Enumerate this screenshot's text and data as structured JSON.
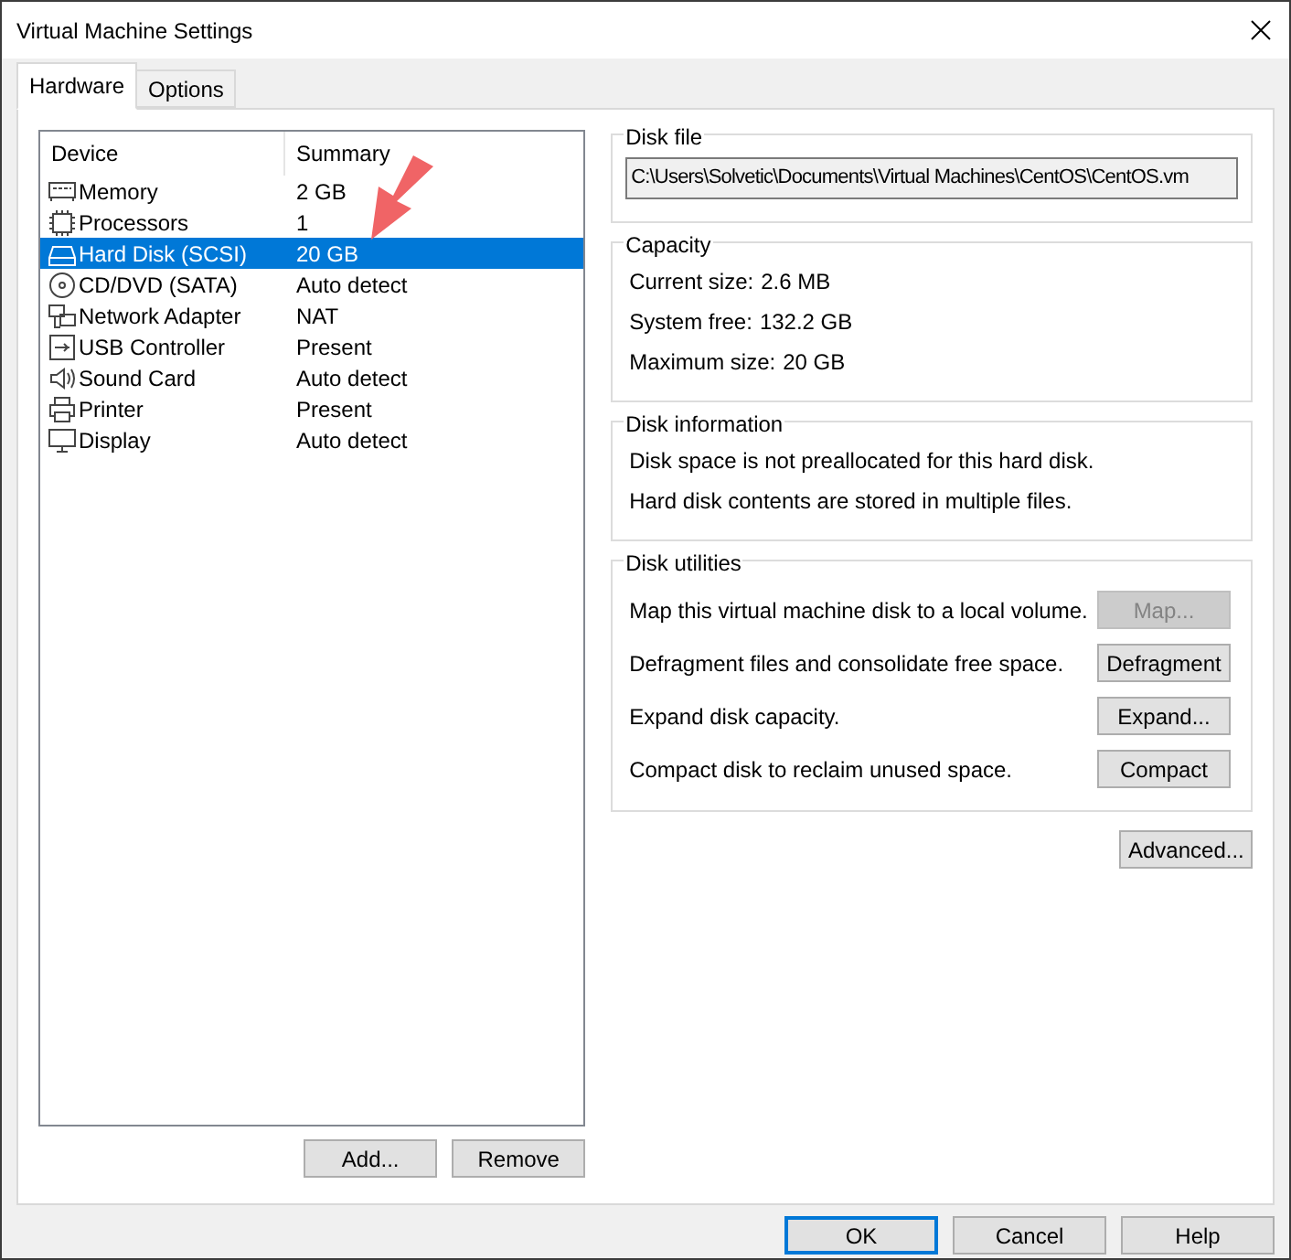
{
  "window": {
    "title": "Virtual Machine Settings"
  },
  "tabs": [
    {
      "label": "Hardware",
      "selected": true
    },
    {
      "label": "Options",
      "selected": false
    }
  ],
  "device_list": {
    "columns": [
      "Device",
      "Summary"
    ],
    "rows": [
      {
        "kind": "memory",
        "device": "Memory",
        "summary": "2 GB",
        "selected": false
      },
      {
        "kind": "processor",
        "device": "Processors",
        "summary": "1",
        "selected": false
      },
      {
        "kind": "disk",
        "device": "Hard Disk (SCSI)",
        "summary": "20 GB",
        "selected": true
      },
      {
        "kind": "cdrom",
        "device": "CD/DVD (SATA)",
        "summary": "Auto detect",
        "selected": false
      },
      {
        "kind": "network",
        "device": "Network Adapter",
        "summary": "NAT",
        "selected": false
      },
      {
        "kind": "usb",
        "device": "USB Controller",
        "summary": "Present",
        "selected": false
      },
      {
        "kind": "sound",
        "device": "Sound Card",
        "summary": "Auto detect",
        "selected": false
      },
      {
        "kind": "printer",
        "device": "Printer",
        "summary": "Present",
        "selected": false
      },
      {
        "kind": "display",
        "device": "Display",
        "summary": "Auto detect",
        "selected": false
      }
    ],
    "buttons": [
      "Add...",
      "Remove"
    ]
  },
  "disk_file": {
    "title": "Disk file",
    "value": "C:\\Users\\Solvetic\\Documents\\Virtual Machines\\CentOS\\CentOS.vm"
  },
  "capacity": {
    "title": "Capacity",
    "rows": [
      {
        "label": "Current size:",
        "value": "2.6 MB"
      },
      {
        "label": "System free:",
        "value": "132.2 GB"
      },
      {
        "label": "Maximum size:",
        "value": "20 GB"
      }
    ]
  },
  "disk_information": {
    "title": "Disk information",
    "lines": [
      "Disk space is not preallocated for this hard disk.",
      "Hard disk contents are stored in multiple files."
    ]
  },
  "disk_utilities": {
    "title": "Disk utilities",
    "rows": [
      {
        "text": "Map this virtual machine disk to a local volume.",
        "button": "Map...",
        "disabled": true
      },
      {
        "text": "Defragment files and consolidate free space.",
        "button": "Defragment",
        "disabled": false
      },
      {
        "text": "Expand disk capacity.",
        "button": "Expand...",
        "disabled": false
      },
      {
        "text": "Compact disk to reclaim unused space.",
        "button": "Compact",
        "disabled": false
      }
    ]
  },
  "advanced_button": "Advanced...",
  "dialog_buttons": [
    {
      "label": "OK",
      "default": true
    },
    {
      "label": "Cancel",
      "default": false
    },
    {
      "label": "Help",
      "default": false
    }
  ]
}
